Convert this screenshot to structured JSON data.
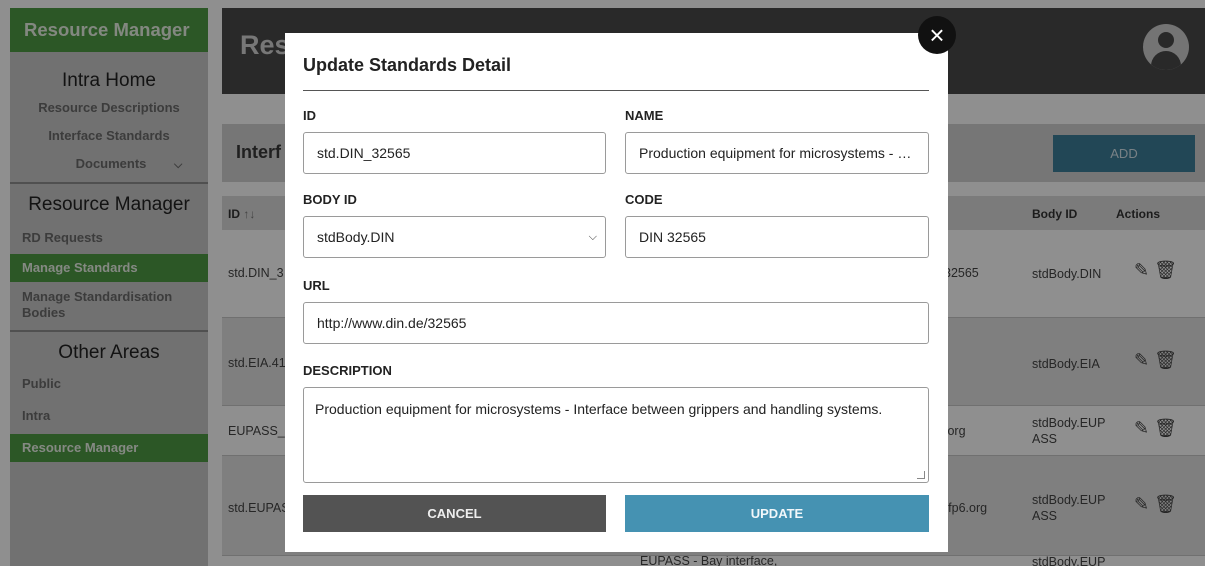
{
  "sidebar": {
    "brand": "Resource Manager",
    "intra_home": {
      "heading": "Intra Home",
      "items": [
        "Resource Descriptions",
        "Interface Standards",
        "Documents"
      ]
    },
    "resource_manager": {
      "heading": "Resource Manager",
      "items": [
        "RD Requests",
        "Manage Standards",
        "Manage Standardisation Bodies"
      ]
    },
    "other_areas": {
      "heading": "Other Areas",
      "items": [
        "Public",
        "Intra",
        "Resource Manager"
      ]
    }
  },
  "header": {
    "title_partial": "Res"
  },
  "page": {
    "title_partial": "Interf",
    "add_label": "ADD",
    "columns": {
      "id": "ID",
      "sort": "↑↓",
      "body_id": "Body ID",
      "actions": "Actions"
    },
    "rows": [
      {
        "id": "std.DIN_3",
        "url": "32565",
        "body": "stdBody.DIN"
      },
      {
        "id": "std.EIA.41",
        "url": "",
        "body": "stdBody.EIA"
      },
      {
        "id": "EUPASS_(",
        "url": ".org",
        "body": "stdBody.EUPASS"
      },
      {
        "id": "std.EUPAS",
        "url": "-fp6.org",
        "body": "stdBody.EUPASS"
      },
      {
        "id": "",
        "url": "",
        "desc": "EUPASS - Bay interface,",
        "body": "stdBody.EUP"
      }
    ]
  },
  "modal": {
    "title": "Update Standards Detail",
    "id_label": "ID",
    "id_value": "std.DIN_32565",
    "name_label": "NAME",
    "name_value": "Production equipment for microsystems - Interface between grippers and handling systems",
    "body_id_label": "BODY ID",
    "body_id_value": "stdBody.DIN",
    "code_label": "CODE",
    "code_value": "DIN 32565",
    "url_label": "URL",
    "url_value": "http://www.din.de/32565",
    "description_label": "DESCRIPTION",
    "description_value": "Production equipment for microsystems - Interface between grippers and handling systems.",
    "cancel_label": "CANCEL",
    "update_label": "UPDATE"
  },
  "icons": {
    "close": "close-icon",
    "avatar": "account-circle-icon",
    "chevron": "chevron-down-icon",
    "edit": "pencil-icon",
    "delete": "trash-icon"
  },
  "colors": {
    "brand_green": "#4f9b45",
    "header_dark": "#4a4a4a",
    "primary_blue": "#4592b2",
    "cancel_gray": "#535353"
  }
}
